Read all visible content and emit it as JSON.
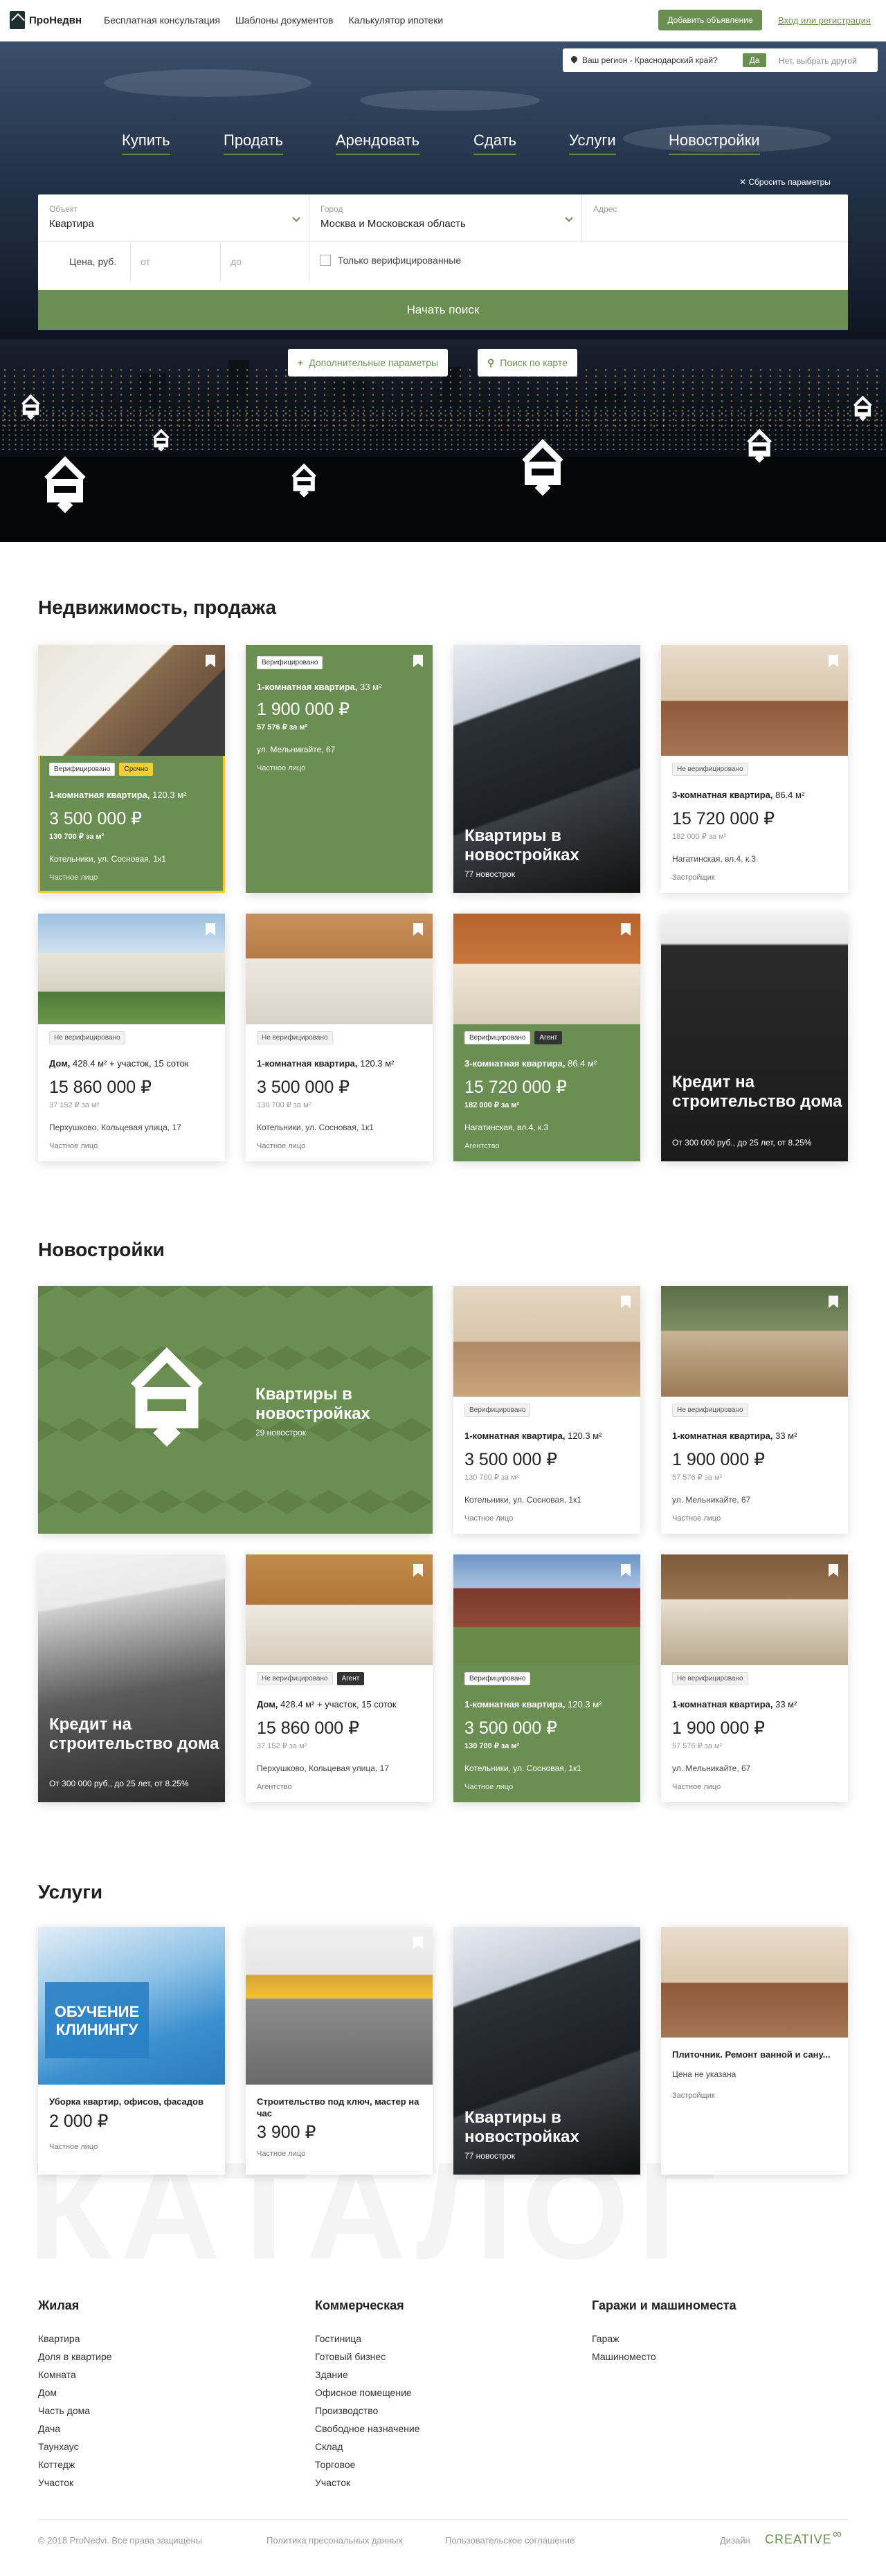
{
  "header": {
    "logo_text": "ПроНедвн",
    "nav": [
      "Бесплатная консультация",
      "Шаблоны документов",
      "Калькулятор ипотеки"
    ],
    "add_button": "Добавить объявление",
    "login_link": "Вход или регистрация"
  },
  "region_bar": {
    "question": "Ваш регион - Краснодарский край?",
    "yes": "Да",
    "other": "Нет, выбрать другой"
  },
  "main_nav": [
    "Купить",
    "Продать",
    "Арендовать",
    "Сдать",
    "Услуги",
    "Новостройки"
  ],
  "search": {
    "reset": "Сбросить параметры",
    "object_label": "Объект",
    "object_value": "Квартира",
    "city_label": "Город",
    "city_value": "Москва и Московская область",
    "address_label": "Адрес",
    "price_label": "Цена, руб.",
    "from_placeholder": "от",
    "to_placeholder": "до",
    "verified_only": "Только верифицированные",
    "submit": "Начать поиск",
    "more_params": "Дополнительные параметры",
    "map_search": "Поиск по карте"
  },
  "sections": {
    "sale": "Недвижимость, продажа",
    "new": "Новостройки",
    "services": "Услуги"
  },
  "sale_cards": [
    {
      "tags": [
        "Верифицировано",
        "Срочно"
      ],
      "title_bold": "1-комнатная квартира,",
      "title_rest": " 120.3 м²",
      "price": "3 500 000 ₽",
      "pm": "130 700 ₽ за м²",
      "addr": "Котельники, ул. Сосновая, 1к1",
      "who": "Частное лицо"
    },
    {
      "tags": [
        "Верифицировано"
      ],
      "title_bold": "1-комнатная квартира,",
      "title_rest": " 33 м²",
      "price": "1 900 000 ₽",
      "pm": "57 576 ₽ за м²",
      "addr": "ул. Мельникайте, 67",
      "who": "Частное лицо"
    },
    {
      "big": "Квартиры в новостройках",
      "sub": "77 новострок"
    },
    {
      "tags": [
        "Не верифицировано"
      ],
      "title_bold": "3-комнатная квартира,",
      "title_rest": " 86.4 м²",
      "price": "15 720 000 ₽",
      "pm": "182 000 ₽ за м²",
      "addr": "Нагатинская, вл.4, к.3",
      "who": "Застройщик"
    },
    {
      "tags": [
        "Не верифицировано"
      ],
      "title_bold": "Дом,",
      "title_rest": " 428.4 м² + участок, 15 соток",
      "price": "15 860 000 ₽",
      "pm": "37 152 ₽ за м²",
      "addr": "Перхушково, Кольцевая улица, 17",
      "who": "Частное лицо"
    },
    {
      "tags": [
        "Не верифицировано"
      ],
      "title_bold": "1-комнатная квартира,",
      "title_rest": " 120.3 м²",
      "price": "3 500 000 ₽",
      "pm": "130 700 ₽ за м²",
      "addr": "Котельники, ул. Сосновая, 1к1",
      "who": "Частное лицо"
    },
    {
      "tags": [
        "Верифицировано",
        "Агент"
      ],
      "title_bold": "3-комнатная квартира,",
      "title_rest": " 86.4 м²",
      "price": "15 720 000 ₽",
      "pm": "182 000 ₽ за м²",
      "addr": "Нагатинская, вл.4, к.3",
      "who": "Агентство"
    },
    {
      "big": "Кредит на строительство дома",
      "sub": "От 300 000 руб., до 25 лет, от 8.25%"
    }
  ],
  "new_cards": [
    {
      "big": "Квартиры в новостройках",
      "sub": "29 новострок"
    },
    {
      "tags": [
        "Верифицировано"
      ],
      "title_bold": "1-комнатная квартира,",
      "title_rest": " 120.3 м²",
      "price": "3 500 000 ₽",
      "pm": "130 700 ₽ за м²",
      "addr": "Котельники, ул. Сосновая, 1к1",
      "who": "Частное лицо"
    },
    {
      "tags": [
        "Не верифицировано"
      ],
      "title_bold": "1-комнатная квартира,",
      "title_rest": " 33 м²",
      "price": "1 900 000 ₽",
      "pm": "57 576 ₽ за м²",
      "addr": "ул. Мельникайте, 67",
      "who": "Частное лицо"
    },
    {
      "big": "Кредит на строительство дома",
      "sub": "От 300 000 руб., до 25 лет, от 8.25%"
    },
    {
      "tags": [
        "Не верифицировано",
        "Агент"
      ],
      "title_bold": "Дом,",
      "title_rest": " 428.4 м² + участок, 15 соток",
      "price": "15 860 000 ₽",
      "pm": "37 152 ₽ за м²",
      "addr": "Перхушково, Кольцевая улица, 17",
      "who": "Агентство"
    },
    {
      "tags": [
        "Верифицировано"
      ],
      "title_bold": "1-комнатная квартира,",
      "title_rest": " 120.3 м²",
      "price": "3 500 000 ₽",
      "pm": "130 700 ₽ за м²",
      "addr": "Котельники, ул. Сосновая, 1к1",
      "who": "Частное лицо"
    },
    {
      "tags": [
        "Не верифицировано"
      ],
      "title_bold": "1-комнатная квартира,",
      "title_rest": " 33 м²",
      "price": "1 900 000 ₽",
      "pm": "57 576 ₽ за м²",
      "addr": "ул. Мельникайте, 67",
      "who": "Частное лицо"
    }
  ],
  "service_cards": [
    {
      "banner": "ОБУЧЕНИЕ КЛИНИНГУ",
      "title": "Уборка квартир, офисов, фасадов",
      "price": "2 000 ₽",
      "who": "Частное лицо"
    },
    {
      "title": "Строительство под ключ, мастер на час",
      "price": "3 900 ₽",
      "who": "Частное лицо"
    },
    {
      "big": "Квартиры в новостройках",
      "sub": "77 новострок"
    },
    {
      "title": "Плиточник. Ремонт ванной и сану...",
      "price_text": "Цена не указана",
      "who": "Застройщик"
    }
  ],
  "watermark": "КАТАЛОГ",
  "footer": {
    "cols": [
      {
        "title": "Жилая",
        "items": [
          "Квартира",
          "Доля в квартире",
          "Комната",
          "Дом",
          "Часть дома",
          "Дача",
          "Таунхаус",
          "Коттедж",
          "Участок"
        ]
      },
      {
        "title": "Коммерческая",
        "items": [
          "Гостиница",
          "Готовый бизнес",
          "Здание",
          "Офисное помещение",
          "Производство",
          "Свободное назначение",
          "Склад",
          "Торговое",
          "Участок"
        ]
      },
      {
        "title": "Гаражи и машиноместа",
        "items": [
          "Гараж",
          "Машиноместо"
        ]
      }
    ],
    "copyright": "© 2018 ProNedvi. Все права защищены",
    "privacy": "Политика пресональных данных",
    "terms": "Пользовательское соглашение",
    "design": "Дизайн",
    "creative": "CREATIVE"
  }
}
